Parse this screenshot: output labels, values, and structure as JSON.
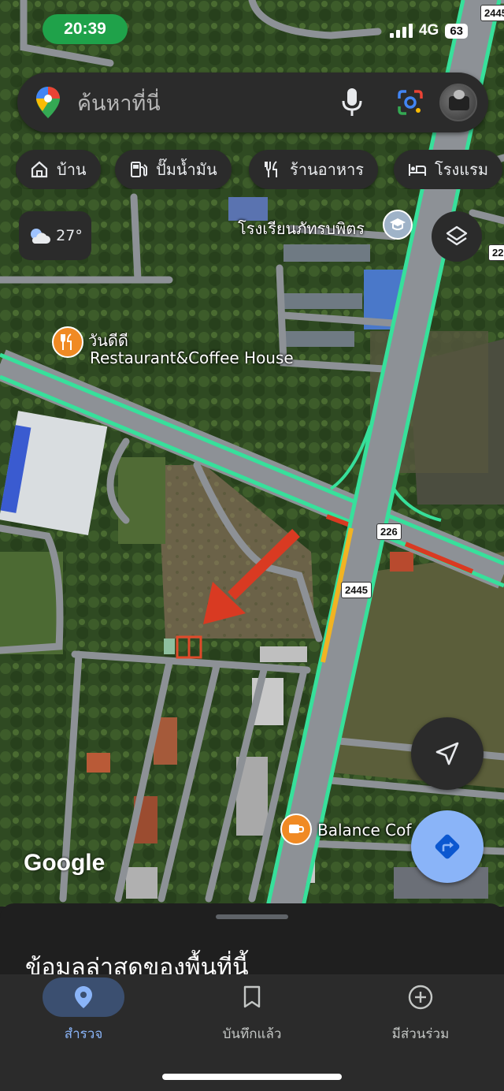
{
  "status": {
    "time": "20:39",
    "network": "4G",
    "battery": "63"
  },
  "search": {
    "placeholder": "ค้นหาที่นี่"
  },
  "chips": [
    {
      "label": "บ้าน",
      "icon": "home-icon"
    },
    {
      "label": "ปั๊มน้ำมัน",
      "icon": "gas-station-icon"
    },
    {
      "label": "ร้านอาหาร",
      "icon": "restaurant-icon"
    },
    {
      "label": "โรงแรม",
      "icon": "hotel-icon"
    }
  ],
  "weather": {
    "temp": "27°",
    "icon": "partly-cloudy-icon"
  },
  "map": {
    "school_label": "โรงเรียนภัทรบพิตร",
    "restaurant_name_th": "วันดีดี",
    "restaurant_name_en": "Restaurant&Coffee House",
    "cafe_label": "Balance Cof",
    "road_226": "226",
    "road_2445_a": "2445",
    "road_2445_b": "2445",
    "road_22_partial": "22",
    "google_logo": "Google",
    "accent_green": "#37e09b",
    "marker_red": "#d93a22"
  },
  "sheet": {
    "title": "ข้อมูลล่าสุดของพื้นที่นี้"
  },
  "nav": [
    {
      "label": "สำรวจ",
      "icon": "explore-pin-icon",
      "active": true
    },
    {
      "label": "บันทึกแล้ว",
      "icon": "bookmark-icon",
      "active": false
    },
    {
      "label": "มีส่วนร่วม",
      "icon": "add-circle-icon",
      "active": false
    }
  ]
}
